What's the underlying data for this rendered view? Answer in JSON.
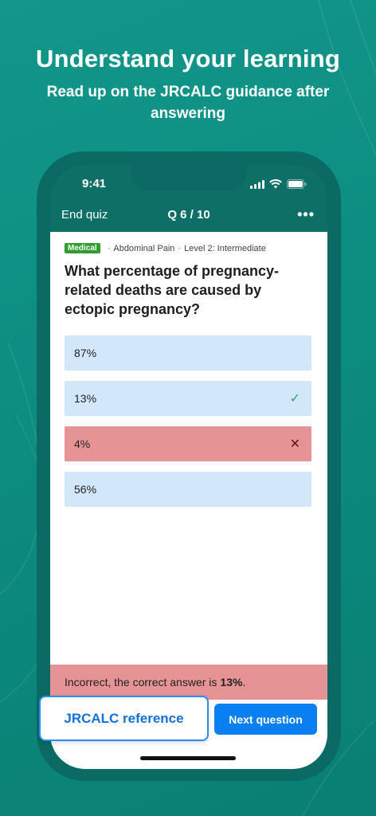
{
  "promo": {
    "headline": "Understand your learning",
    "subline": "Read up on the JRCALC guidance after answering"
  },
  "status_bar": {
    "time": "9:41",
    "icons": [
      "signal-icon",
      "wifi-icon",
      "battery-icon"
    ]
  },
  "nav": {
    "end_label": "End quiz",
    "title": "Q 6 / 10",
    "more_icon": "more-dots-icon",
    "more_glyph": "•••"
  },
  "question_meta": {
    "category": "Medical",
    "topic": "Abdominal Pain",
    "level": "Level 2: Intermediate",
    "separator": "·"
  },
  "question": {
    "text": "What percentage of pregnancy-related deaths are caused by ectopic pregnancy?"
  },
  "answers": [
    {
      "label": "87%",
      "state": "neutral"
    },
    {
      "label": "13%",
      "state": "correct",
      "mark": "✓"
    },
    {
      "label": "4%",
      "state": "wrong",
      "mark": "✕"
    },
    {
      "label": "56%",
      "state": "neutral"
    }
  ],
  "feedback": {
    "prefix": "Incorrect, the correct answer is",
    "answer": "13%",
    "suffix": "."
  },
  "buttons": {
    "next": "Next question",
    "reference": "JRCALC reference"
  },
  "colors": {
    "background": "#0c8a7e",
    "correct_answer_bg": "#d3e7fb",
    "wrong_answer_bg": "#e59395",
    "primary_button": "#0a7ff2",
    "badge_green": "#2e9e2f"
  }
}
